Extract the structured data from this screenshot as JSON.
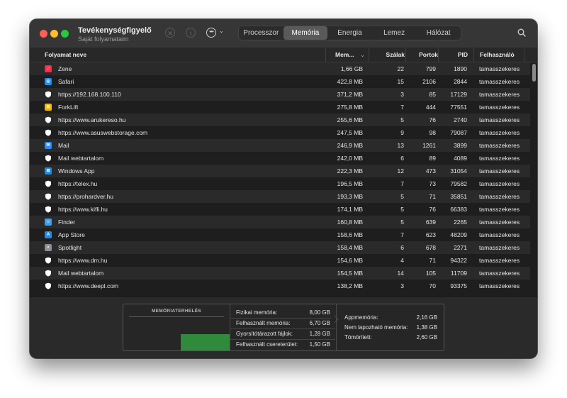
{
  "window": {
    "title": "Tevékenységfigyelő",
    "subtitle": "Saját folyamataim"
  },
  "toolbar": {
    "stop_icon": "x-circle-icon",
    "info_icon": "info-icon",
    "more_icon": "ellipsis-circle-icon",
    "search_icon": "search-icon"
  },
  "tabs": [
    {
      "label": "Processzor",
      "active": false
    },
    {
      "label": "Memória",
      "active": true
    },
    {
      "label": "Energia",
      "active": false
    },
    {
      "label": "Lemez",
      "active": false
    },
    {
      "label": "Hálózat",
      "active": false
    }
  ],
  "columns": {
    "name": "Folyamat neve",
    "memory": "Mem...",
    "threads": "Szálak",
    "ports": "Portok",
    "pid": "PID",
    "user": "Felhasználó"
  },
  "processes": [
    {
      "name": "Zene",
      "icon": "music-icon",
      "icon_color": "#fa2d48",
      "memory": "1,66 GB",
      "threads": "22",
      "ports": "799",
      "pid": "1890",
      "user": "tamasszekeres"
    },
    {
      "name": "Safari",
      "icon": "safari-icon",
      "icon_color": "#1f8ff0",
      "memory": "422,8 MB",
      "threads": "15",
      "ports": "2106",
      "pid": "2844",
      "user": "tamasszekeres"
    },
    {
      "name": "https://192.168.100.110",
      "icon": "shield-icon",
      "icon_color": "#ffffff",
      "memory": "371,2 MB",
      "threads": "3",
      "ports": "85",
      "pid": "17129",
      "user": "tamasszekeres"
    },
    {
      "name": "ForkLift",
      "icon": "forklift-icon",
      "icon_color": "#f2b705",
      "memory": "275,8 MB",
      "threads": "7",
      "ports": "444",
      "pid": "77551",
      "user": "tamasszekeres"
    },
    {
      "name": "https://www.arukereso.hu",
      "icon": "shield-icon",
      "icon_color": "#ffffff",
      "memory": "255,6 MB",
      "threads": "5",
      "ports": "76",
      "pid": "2740",
      "user": "tamasszekeres"
    },
    {
      "name": "https://www.asuswebstorage.com",
      "icon": "shield-icon",
      "icon_color": "#ffffff",
      "memory": "247,5 MB",
      "threads": "9",
      "ports": "98",
      "pid": "79087",
      "user": "tamasszekeres"
    },
    {
      "name": "Mail",
      "icon": "mail-icon",
      "icon_color": "#2a8cf5",
      "memory": "246,9 MB",
      "threads": "13",
      "ports": "1261",
      "pid": "3899",
      "user": "tamasszekeres"
    },
    {
      "name": "Mail webtartalom",
      "icon": "shield-icon",
      "icon_color": "#ffffff",
      "memory": "242,0 MB",
      "threads": "6",
      "ports": "89",
      "pid": "4089",
      "user": "tamasszekeres"
    },
    {
      "name": "Windows App",
      "icon": "windows-app-icon",
      "icon_color": "#1a8ce8",
      "memory": "222,3 MB",
      "threads": "12",
      "ports": "473",
      "pid": "31054",
      "user": "tamasszekeres"
    },
    {
      "name": "https://telex.hu",
      "icon": "shield-icon",
      "icon_color": "#ffffff",
      "memory": "196,5 MB",
      "threads": "7",
      "ports": "73",
      "pid": "79582",
      "user": "tamasszekeres"
    },
    {
      "name": "https://prohardver.hu",
      "icon": "shield-icon",
      "icon_color": "#ffffff",
      "memory": "193,3 MB",
      "threads": "5",
      "ports": "71",
      "pid": "35851",
      "user": "tamasszekeres"
    },
    {
      "name": "https://www.kifli.hu",
      "icon": "shield-icon",
      "icon_color": "#ffffff",
      "memory": "174,1 MB",
      "threads": "5",
      "ports": "76",
      "pid": "66383",
      "user": "tamasszekeres"
    },
    {
      "name": "Finder",
      "icon": "finder-icon",
      "icon_color": "#3aa0f5",
      "memory": "160,8 MB",
      "threads": "5",
      "ports": "639",
      "pid": "2265",
      "user": "tamasszekeres"
    },
    {
      "name": "App Store",
      "icon": "app-store-icon",
      "icon_color": "#1a8cf0",
      "memory": "158,6 MB",
      "threads": "7",
      "ports": "623",
      "pid": "48209",
      "user": "tamasszekeres"
    },
    {
      "name": "Spotlight",
      "icon": "spotlight-icon",
      "icon_color": "#8e8e93",
      "memory": "158,4 MB",
      "threads": "6",
      "ports": "678",
      "pid": "2271",
      "user": "tamasszekeres"
    },
    {
      "name": "https://www.dm.hu",
      "icon": "shield-icon",
      "icon_color": "#ffffff",
      "memory": "154,6 MB",
      "threads": "4",
      "ports": "71",
      "pid": "94322",
      "user": "tamasszekeres"
    },
    {
      "name": "Mail webtartalom",
      "icon": "shield-icon",
      "icon_color": "#ffffff",
      "memory": "154,5 MB",
      "threads": "14",
      "ports": "105",
      "pid": "11709",
      "user": "tamasszekeres"
    },
    {
      "name": "https://www.deepl.com",
      "icon": "shield-icon",
      "icon_color": "#ffffff",
      "memory": "138,2 MB",
      "threads": "3",
      "ports": "70",
      "pid": "93375",
      "user": "tamasszekeres"
    }
  ],
  "memory_pressure": {
    "title": "MEMÓRIATERHELÉS",
    "color": "#2f8a3c"
  },
  "memory_stats": [
    {
      "label": "Fizikai memória:",
      "value": "8,00 GB"
    },
    {
      "label": "Felhasznált memória:",
      "value": "6,70 GB"
    },
    {
      "label": "Gyorsítótárazott fájlok:",
      "value": "1,28 GB"
    },
    {
      "label": "Felhasznált csereterület:",
      "value": "1,50 GB"
    }
  ],
  "memory_breakdown": [
    {
      "label": "Appmemória:",
      "value": "2,16 GB"
    },
    {
      "label": "Nem lapozható memória:",
      "value": "1,38 GB"
    },
    {
      "label": "Tömörített:",
      "value": "2,60 GB"
    }
  ]
}
